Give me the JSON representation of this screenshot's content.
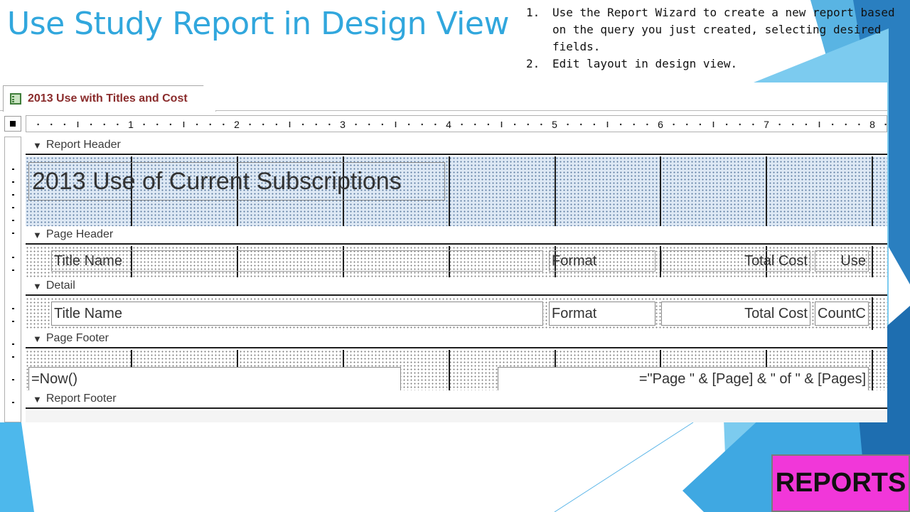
{
  "slide": {
    "title": "Use Study Report in Design View",
    "steps": [
      {
        "num": "1.",
        "text": "Use the Report Wizard to create a new report based on the query you just created, selecting desired fields."
      },
      {
        "num": "2.",
        "text": "Edit layout in design view."
      }
    ],
    "badge": "REPORTS",
    "colors": {
      "title": "#31a7dd",
      "badge": "#f137d9",
      "accent_blue": "#2a7fc0"
    }
  },
  "access": {
    "tab_label": "2013 Use with Titles and Cost",
    "tab_icon": "report-icon",
    "ruler_numbers": [
      "1",
      "2",
      "3",
      "4",
      "5",
      "6",
      "7",
      "8"
    ],
    "sections": {
      "report_header": "Report Header",
      "page_header": "Page Header",
      "detail": "Detail",
      "page_footer": "Page Footer",
      "report_footer": "Report Footer"
    },
    "report_title": "2013 Use of Current Subscriptions",
    "page_header_labels": {
      "title_name": "Title Name",
      "format": "Format",
      "total_cost": "Total Cost",
      "use": "Use"
    },
    "detail_fields": {
      "title_name": "Title Name",
      "format": "Format",
      "total_cost": "Total Cost",
      "count": "CountC"
    },
    "page_footer_fields": {
      "now": "=Now()",
      "page": "=\"Page \" & [Page] & \" of \" & [Pages]"
    }
  }
}
